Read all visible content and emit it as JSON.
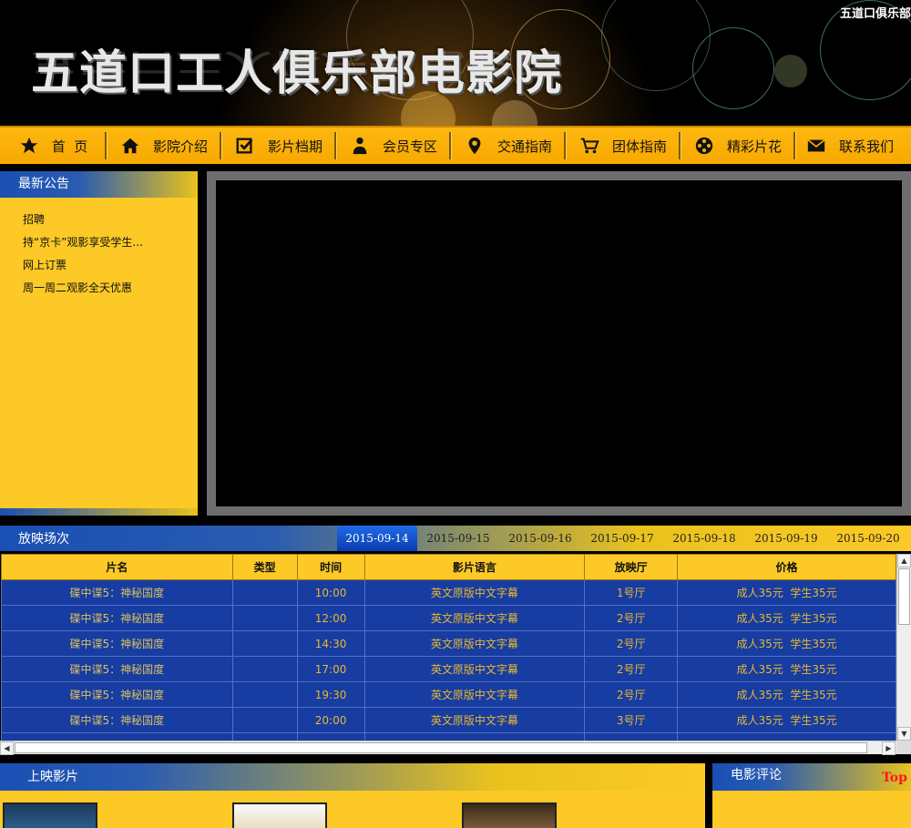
{
  "header": {
    "site_title": "五道口工人俱乐部电影院",
    "corner_title": "五道口俱乐部"
  },
  "nav": [
    {
      "label": "首  页",
      "icon": "star-icon"
    },
    {
      "label": "影院介绍",
      "icon": "home-icon"
    },
    {
      "label": "影片档期",
      "icon": "checkbox-icon"
    },
    {
      "label": "会员专区",
      "icon": "user-icon"
    },
    {
      "label": "交通指南",
      "icon": "map-pin-icon"
    },
    {
      "label": "团体指南",
      "icon": "cart-icon"
    },
    {
      "label": "精彩片花",
      "icon": "film-reel-icon"
    },
    {
      "label": "联系我们",
      "icon": "envelope-icon"
    }
  ],
  "notice": {
    "title": "最新公告",
    "items": [
      "招聘",
      "持“京卡”观影享受学生...",
      "网上订票",
      "周一周二观影全天优惠"
    ]
  },
  "showtimes": {
    "title": "放映场次",
    "dates": [
      "2015-09-14",
      "2015-09-15",
      "2015-09-16",
      "2015-09-17",
      "2015-09-18",
      "2015-09-19",
      "2015-09-20"
    ],
    "active_date": "2015-09-14",
    "columns": [
      "片名",
      "类型",
      "时间",
      "影片语言",
      "放映厅",
      "价格"
    ],
    "rows": [
      [
        "碟中谍5：神秘国度",
        "",
        "10:00",
        "英文原版中文字幕",
        "1号厅",
        "成人35元  学生35元"
      ],
      [
        "碟中谍5：神秘国度",
        "",
        "12:00",
        "英文原版中文字幕",
        "2号厅",
        "成人35元  学生35元"
      ],
      [
        "碟中谍5：神秘国度",
        "",
        "14:30",
        "英文原版中文字幕",
        "2号厅",
        "成人35元  学生35元"
      ],
      [
        "碟中谍5：神秘国度",
        "",
        "17:00",
        "英文原版中文字幕",
        "2号厅",
        "成人35元  学生35元"
      ],
      [
        "碟中谍5：神秘国度",
        "",
        "19:30",
        "英文原版中文字幕",
        "2号厅",
        "成人35元  学生35元"
      ],
      [
        "碟中谍5：神秘国度",
        "",
        "20:00",
        "英文原版中文字幕",
        "3号厅",
        "成人35元  学生35元"
      ]
    ]
  },
  "now_showing": {
    "title": "上映影片"
  },
  "reviews": {
    "title": "电影评论"
  },
  "top_link": "Top",
  "colors": {
    "accent_yellow": "#fcc926",
    "nav_orange": "#f7a900",
    "table_blue": "#173ca2",
    "tab_blue": "#0b3bb0",
    "top_red": "#ff1a1a"
  }
}
